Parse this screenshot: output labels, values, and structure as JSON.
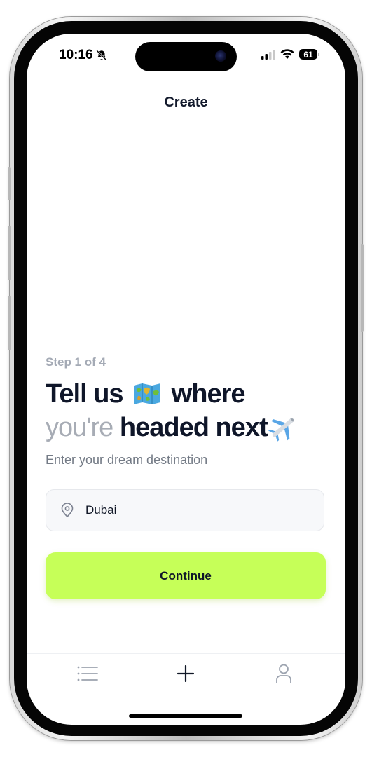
{
  "status_bar": {
    "time": "10:16",
    "battery": "61"
  },
  "header": {
    "title": "Create"
  },
  "main": {
    "step_label": "Step 1 of 4",
    "headline_part1": "Tell us",
    "headline_part2": "where",
    "headline_part3": "you're",
    "headline_part4": "headed next",
    "subtitle": "Enter your dream destination",
    "destination_input": {
      "value": "Dubai",
      "icon": "location-pin-icon"
    },
    "continue_label": "Continue"
  },
  "tab_bar": {
    "items": [
      {
        "icon": "list-icon"
      },
      {
        "icon": "plus-icon"
      },
      {
        "icon": "profile-icon"
      }
    ]
  },
  "colors": {
    "accent": "#c6ff58",
    "text_primary": "#0f1629",
    "text_muted": "#a7acb5"
  }
}
